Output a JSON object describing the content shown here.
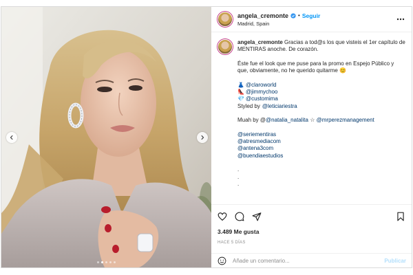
{
  "post": {
    "username": "angela_cremonte",
    "separator": "•",
    "follow_label": "Seguir",
    "location": "Madrid, Spain",
    "verified_icon": "verified-badge-icon",
    "accent_color": "#0095f6",
    "link_color": "#00376b"
  },
  "caption": {
    "username": "angela_cremonte",
    "line1": "Gracias a tod@s los que visteis el 1er capítulo de MENTIRAS anoche. De corazón.",
    "line2": "Éste fue el look que me puse para la promo en Espejo Público y que, obviamente, no he querido quitarme",
    "line2_emoji": "😊",
    "credits": [
      {
        "emoji": "👗",
        "handle": "@claroworld"
      },
      {
        "emoji": "👠",
        "handle": "@jimmychoo"
      },
      {
        "emoji": "💎",
        "handle": "@customima"
      }
    ],
    "styled_by_label": "Styled by",
    "styled_by_handle": "@leticiariestra",
    "muah_prefix": "Muah by @",
    "muah_handle": "@natalia_natalita",
    "muah_star": "☆",
    "muah_handle2": "@mrperezmanagement",
    "tags": [
      "@seriementiras",
      "@atresmediacom",
      "@antena3com",
      "@buendiaestudios"
    ],
    "dots": [
      ".",
      ".",
      "."
    ]
  },
  "engagement": {
    "likes": "3.489 Me gusta",
    "time_ago": "HACE 5 DÍAS"
  },
  "comment_box": {
    "placeholder": "Añade un comentario...",
    "publish_label": "Publicar"
  },
  "carousel": {
    "total": 5,
    "active": 1
  }
}
